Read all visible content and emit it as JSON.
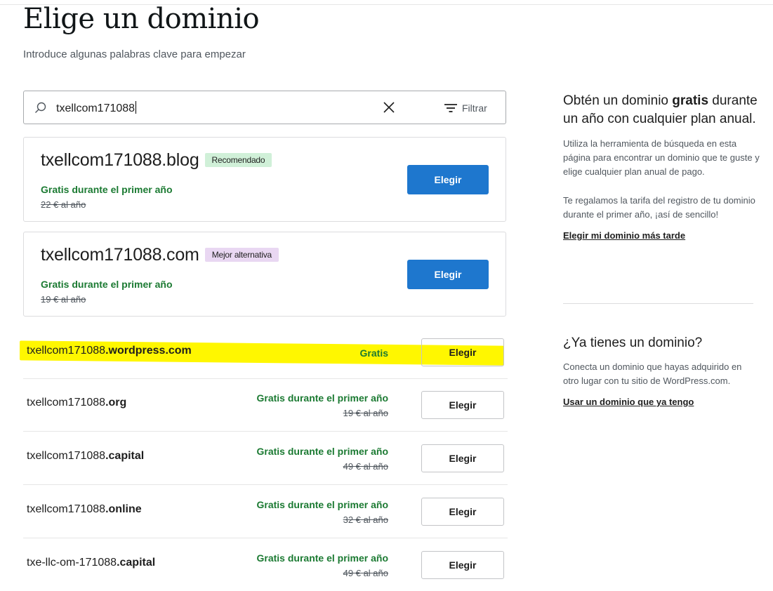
{
  "header": {
    "title": "Elige un dominio",
    "subtitle": "Introduce algunas palabras clave para empezar"
  },
  "search": {
    "value": "txellcom171088",
    "filter_label": "Filtrar",
    "icons": {
      "search": "search-icon",
      "clear": "close-icon",
      "filter": "filter-icon"
    }
  },
  "featured": [
    {
      "name": "txellcom171088.blog",
      "badge": "Recomendado",
      "free_label": "Gratis durante el primer año",
      "old_price": "22 € al año",
      "button": "Elegir"
    },
    {
      "name": "txellcom171088.com",
      "badge": "Mejor alternativa",
      "free_label": "Gratis durante el primer año",
      "old_price": "19 € al año",
      "button": "Elegir"
    }
  ],
  "results": [
    {
      "base": "txellcom171088",
      "tld": ".wordpress.com",
      "free_label": "Gratis",
      "old_price": "",
      "button": "Elegir",
      "highlighted": true
    },
    {
      "base": "txellcom171088",
      "tld": ".org",
      "free_label": "Gratis durante el primer año",
      "old_price": "19 € al año",
      "button": "Elegir"
    },
    {
      "base": "txellcom171088",
      "tld": ".capital",
      "free_label": "Gratis durante el primer año",
      "old_price": "49 € al año",
      "button": "Elegir"
    },
    {
      "base": "txellcom171088",
      "tld": ".online",
      "free_label": "Gratis durante el primer año",
      "old_price": "32 € al año",
      "button": "Elegir"
    },
    {
      "base": "txe-llc-om-171088",
      "tld": ".capital",
      "free_label": "Gratis durante el primer año",
      "old_price": "49 € al año",
      "button": "Elegir"
    }
  ],
  "sidebar": {
    "promo_heading_pre": "Obtén un dominio ",
    "promo_heading_bold": "gratis",
    "promo_heading_post": " durante un año con cualquier plan anual.",
    "promo_p1": "Utiliza la herramienta de búsqueda en esta página para encontrar un dominio que te guste y elige cualquier plan anual de pago.",
    "promo_p2": "Te regalamos la tarifa del registro de tu dominio durante el primer año, ¡así de sencillo!",
    "promo_link": "Elegir mi dominio más tarde",
    "own_heading": "¿Ya tienes un dominio?",
    "own_p": "Conecta un dominio que hayas adquirido en otro lugar con tu sitio de WordPress.com.",
    "own_link": "Usar un dominio que ya tengo"
  },
  "colors": {
    "primary_button": "#1e77ce",
    "free_text": "#1b7a32",
    "badge_recommended": "#d0f0d8",
    "badge_alternative": "#e9d7f2",
    "highlight": "#fff700"
  }
}
